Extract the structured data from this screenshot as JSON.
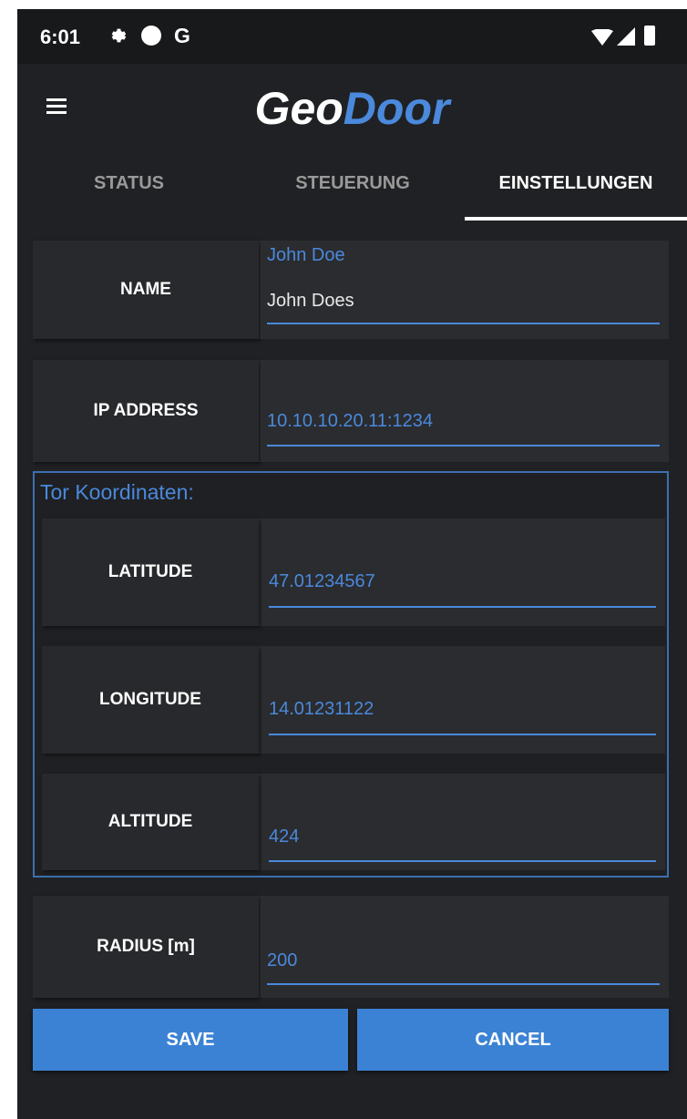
{
  "status_bar": {
    "time": "6:01",
    "carrier_letter": "G",
    "icons": [
      "gear-icon",
      "circle-icon",
      "wifi-icon",
      "signal-icon",
      "battery-icon"
    ]
  },
  "app_bar": {
    "title_part1": "Geo",
    "title_part2": "Door",
    "menu_icon": "hamburger-menu-icon"
  },
  "tabs": [
    {
      "label": "STATUS",
      "active": false
    },
    {
      "label": "STEUERUNG",
      "active": false
    },
    {
      "label": "EINSTELLUNGEN",
      "active": true
    }
  ],
  "fields": {
    "name": {
      "label": "NAME",
      "hint": "John Doe",
      "value": "John Does"
    },
    "ip_address": {
      "label": "IP ADDRESS",
      "value": "10.10.10.20.11:1234"
    },
    "radius": {
      "label": "RADIUS [m]",
      "value": "200"
    }
  },
  "coordinates": {
    "title": "Tor Koordinaten:",
    "latitude": {
      "label": "LATITUDE",
      "value": "47.01234567"
    },
    "longitude": {
      "label": "LONGITUDE",
      "value": "14.01231122"
    },
    "altitude": {
      "label": "ALTITUDE",
      "value": "424"
    }
  },
  "buttons": {
    "save": "SAVE",
    "cancel": "CANCEL"
  },
  "colors": {
    "accent": "#4a89dc",
    "button": "#3b82d4",
    "background": "#202124"
  }
}
